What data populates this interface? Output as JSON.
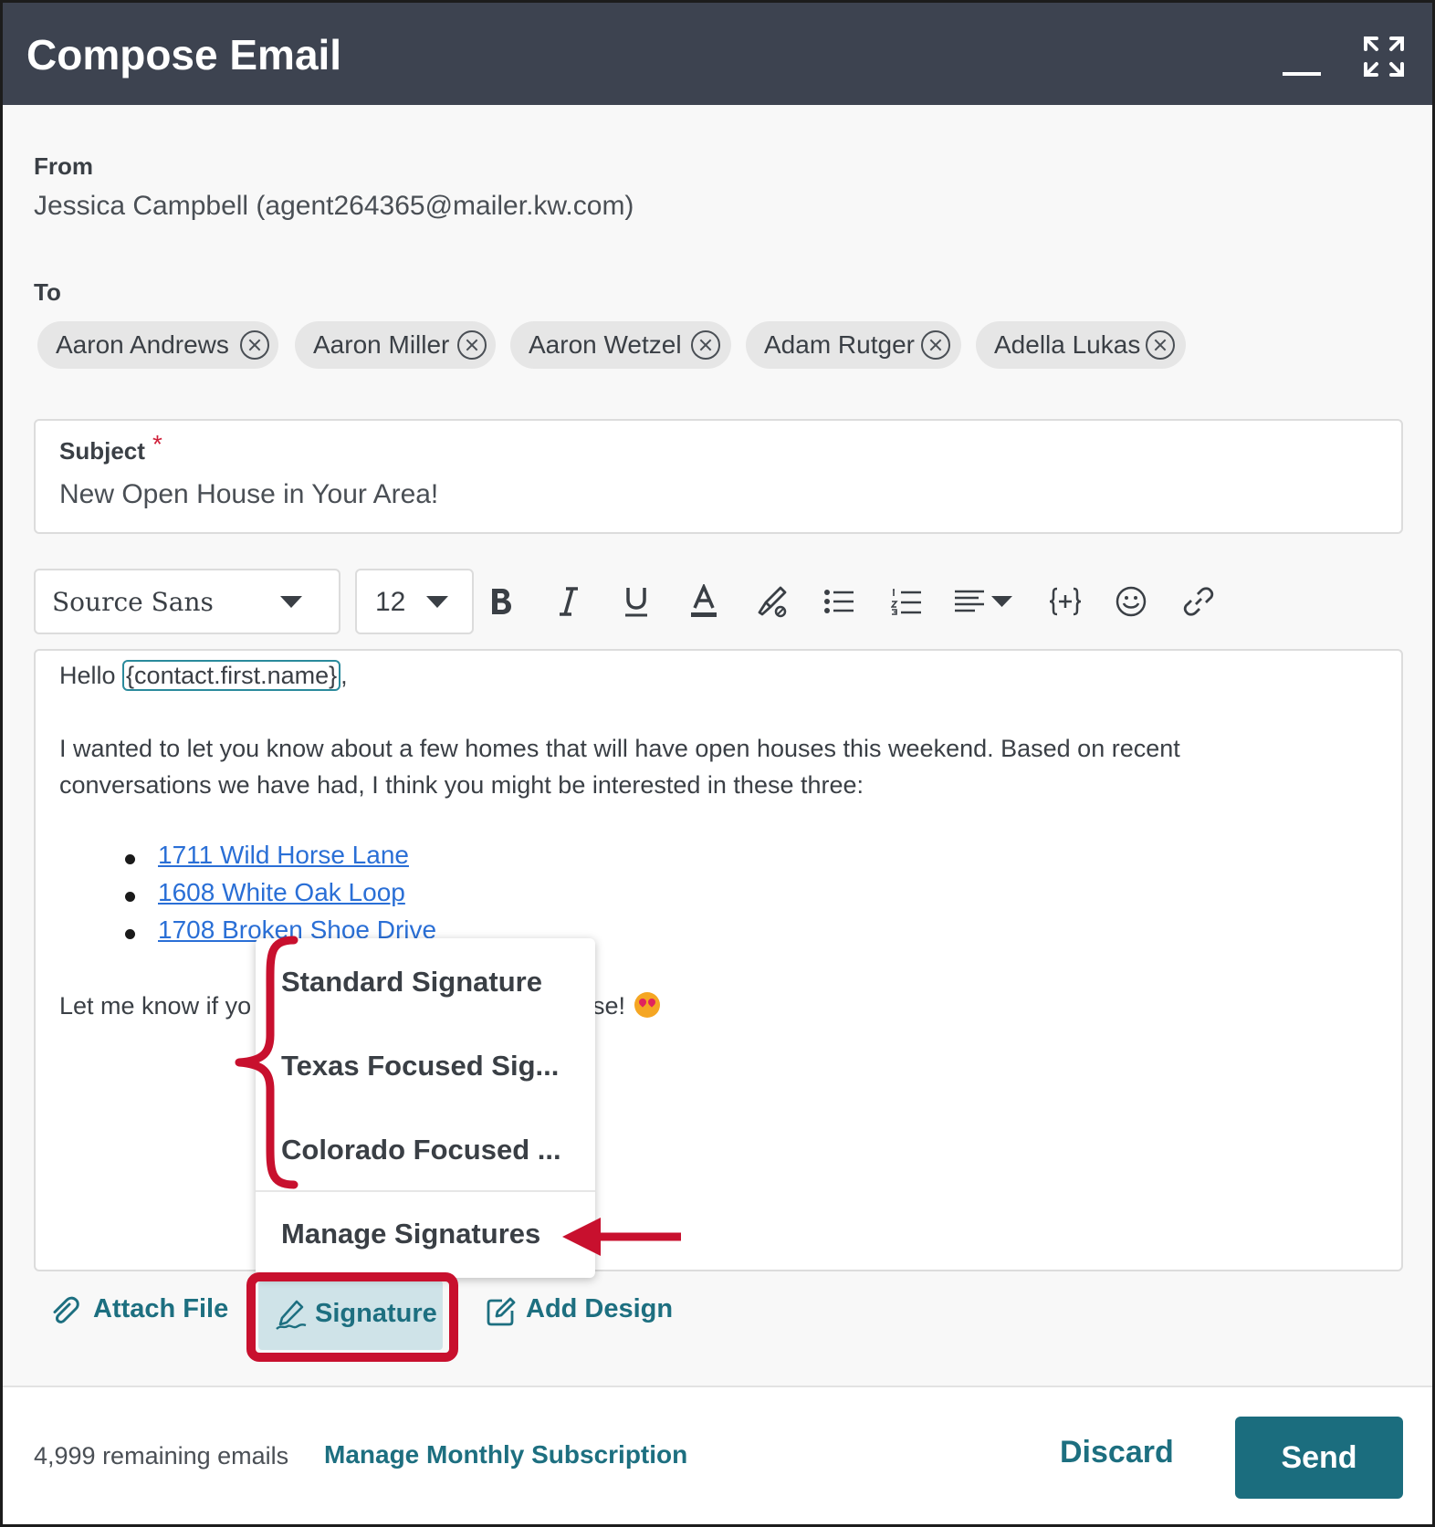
{
  "window": {
    "title": "Compose Email",
    "minimize_icon": "minimize-icon",
    "expand_icon": "expand-icon"
  },
  "from": {
    "label": "From",
    "value": "Jessica Campbell (agent264365@mailer.kw.com)"
  },
  "to": {
    "label": "To",
    "recipients": [
      "Aaron Andrews",
      "Aaron Miller",
      "Aaron Wetzel",
      "Adam Rutger",
      "Adella Lukas"
    ]
  },
  "subject": {
    "label": "Subject",
    "required_mark": "*",
    "value": "New Open House in Your Area!"
  },
  "toolbar": {
    "font": "Source Sans",
    "size": "12",
    "buttons": [
      "bold-icon",
      "italic-icon",
      "underline-icon",
      "text-color-icon",
      "highlight-icon",
      "bulleted-list-icon",
      "numbered-list-icon",
      "align-icon",
      "merge-field-icon",
      "emoji-icon",
      "link-icon"
    ]
  },
  "body": {
    "greeting_prefix": "Hello ",
    "greeting_token": "{contact.first.name}",
    "greeting_suffix": ",",
    "para1_line1": "I wanted to let you know about a few homes that will have open houses this weekend. Based on recent",
    "para1_line2": "conversations we have had, I think you might be interested in these three:",
    "links": [
      "1711 Wild Horse Lane",
      "1608 White Oak Loop",
      "1708 Broken Shoe Drive"
    ],
    "closing_left": "Let me know if yo",
    "closing_right": "se!"
  },
  "signature_menu": {
    "items": [
      "Standard Signature",
      "Texas Focused Sig...",
      "Colorado Focused ..."
    ],
    "manage": "Manage Signatures"
  },
  "actions": {
    "attach": "Attach File",
    "signature": "Signature",
    "design": "Add Design"
  },
  "footer": {
    "remaining": "4,999 remaining emails",
    "manage_subscription": "Manage Monthly Subscription",
    "discard": "Discard",
    "send": "Send"
  },
  "colors": {
    "header_bg": "#3d4350",
    "accent": "#1b6d7e",
    "link": "#2a6fd6",
    "annotation": "#c8102e",
    "signature_active_bg": "#cfe3e8"
  }
}
